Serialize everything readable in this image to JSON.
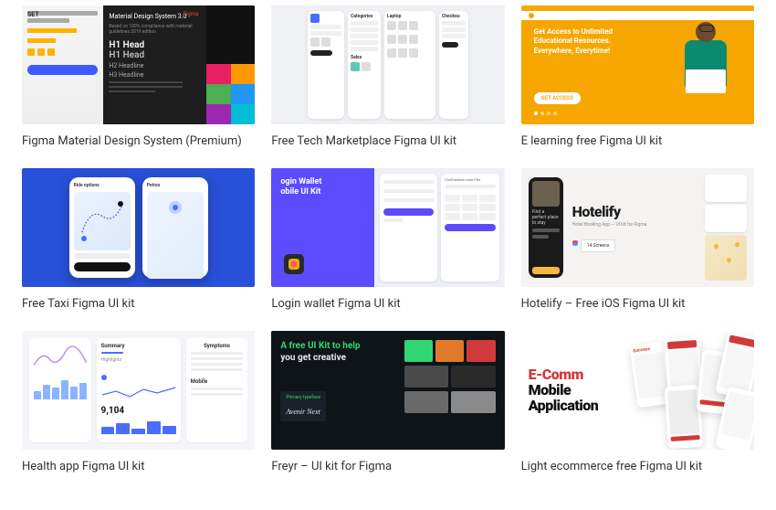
{
  "cards": [
    {
      "title": "Figma Material Design System (Premium)",
      "thumb": {
        "brand": "SET",
        "heading": "Material Design System 3.0",
        "subheading": "Based on 100% compliance with material guidelines 2019 edition",
        "platform": "Figma",
        "h1": "H1 Head",
        "h1b": "H1 Head",
        "h2": "H2 Headline",
        "h3": "H3 Headline"
      }
    },
    {
      "title": "Free Tech Marketplace Figma UI kit",
      "thumb": {
        "cat_label": "Categories",
        "checkout": "Checkou",
        "laptop": "Laptop",
        "sales": "Sales"
      }
    },
    {
      "title": "E learning free Figma UI kit",
      "thumb": {
        "headline": "Get Access to Unlimited Educational Resources. Everywhere, Everytime!",
        "cta": "GET ACCESS"
      }
    },
    {
      "title": "Free Taxi Figma UI kit",
      "thumb": {
        "screen_a": "Ride options",
        "screen_b": "Petros"
      }
    },
    {
      "title": "Login wallet Figma UI kit",
      "thumb": {
        "headline_a": "ogin Wallet",
        "headline_b": "obile UI Kit",
        "panel_label": "Confidential code PIN"
      }
    },
    {
      "title": "Hotelify – Free iOS Figma UI kit",
      "thumb": {
        "brand": "Hotelify",
        "tagline": "Hotel Booking App — UI kit for Figma",
        "badge": "14 Screens",
        "phone_text": "Find a perfect place to stay"
      }
    },
    {
      "title": "Health app Figma UI kit",
      "thumb": {
        "panel1": "Summary",
        "panel1_sub": "Highlights",
        "panel2": "Symptoms",
        "panel3": "Mobile",
        "stat": "9,104"
      }
    },
    {
      "title": "Freyr – UI kit for Figma",
      "thumb": {
        "headline_a": "A free UI Kit to help",
        "headline_b": "you get creative",
        "font_label": "Primary typeface",
        "font_name": "Avenir Next",
        "swatches": [
          "#2fd671",
          "#e07a2a",
          "#d13a3a",
          "#4a4a4a",
          "#2a2a2a",
          "#6a6a6a",
          "#8a8a8a"
        ]
      }
    },
    {
      "title": "Light ecommerce free Figma UI kit",
      "thumb": {
        "line1": "E-Comm",
        "line2": "Mobile",
        "line3": "Application",
        "badge": "Success"
      }
    }
  ]
}
